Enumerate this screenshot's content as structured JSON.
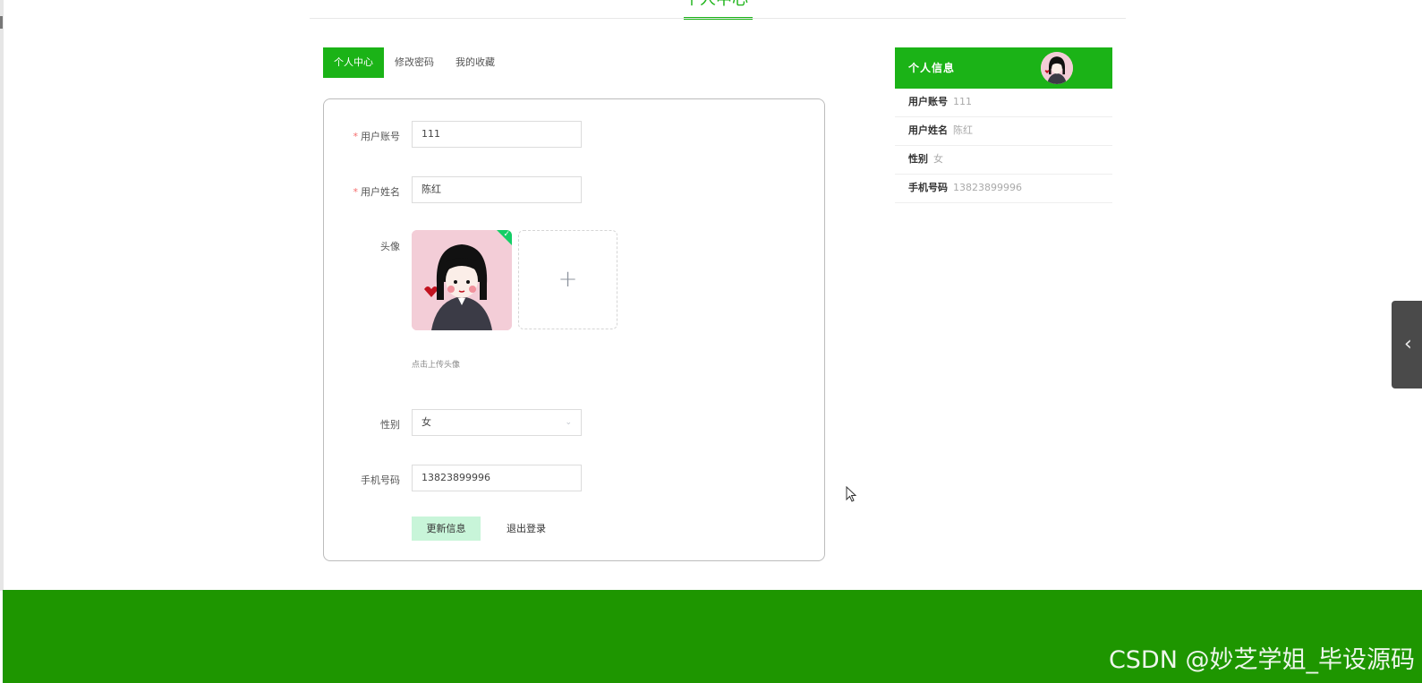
{
  "header": {
    "title": "个人中心"
  },
  "tabs": [
    {
      "label": "个人中心"
    },
    {
      "label": "修改密码"
    },
    {
      "label": "我的收藏"
    }
  ],
  "form": {
    "account_label": "用户账号",
    "account_value": "111",
    "name_label": "用户姓名",
    "name_value": "陈红",
    "avatar_label": "头像",
    "upload_hint": "点击上传头像",
    "gender_label": "性别",
    "gender_value": "女",
    "phone_label": "手机号码",
    "phone_value": "13823899996",
    "required_mark": "*",
    "update_button": "更新信息",
    "logout_button": "退出登录"
  },
  "info_card": {
    "title": "个人信息",
    "rows": [
      {
        "key": "用户账号",
        "value": "111"
      },
      {
        "key": "用户姓名",
        "value": "陈红"
      },
      {
        "key": "性别",
        "value": "女"
      },
      {
        "key": "手机号码",
        "value": "13823899996"
      }
    ]
  },
  "watermark": "CSDN @妙芝学姐_毕设源码",
  "colors": {
    "accent": "#1bb317",
    "footer": "#1e9600",
    "update_button_bg": "#c8f5d9"
  },
  "icons": {
    "upload": "plus-icon",
    "side_toggle": "chevron-left-icon",
    "select": "chevron-down-icon"
  }
}
